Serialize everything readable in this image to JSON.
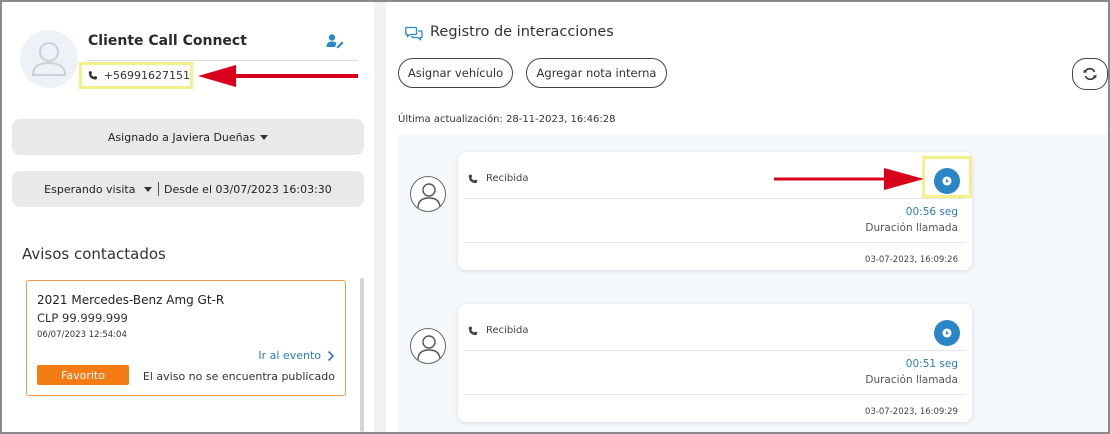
{
  "contact": {
    "name": "Cliente Call Connect",
    "phone": "+56991627151"
  },
  "assignment": {
    "label": "Asignado a Javiera Dueñas"
  },
  "status": {
    "label": "Esperando visita",
    "since": "Desde el 03/07/2023 16:03:30"
  },
  "avisos": {
    "title": "Avisos contactados",
    "items": [
      {
        "title": "2021 Mercedes-Benz Amg Gt-R",
        "price": "CLP 99.999.999",
        "date": "06/07/2023 12:54:04",
        "link": "Ir al evento",
        "favorite": "Favorito",
        "status": "El aviso no se encuentra publicado"
      }
    ]
  },
  "registro": {
    "title": "Registro de interacciones",
    "actions": {
      "assign_vehicle": "Asignar vehículo",
      "add_note": "Agregar nota interna"
    },
    "last_update": "Última actualización: 28-11-2023, 16:46:28",
    "entries": [
      {
        "kind": "Recibida",
        "duration": "00:56 seg",
        "duration_label": "Duración llamada",
        "timestamp": "03-07-2023, 16:09:26"
      },
      {
        "kind": "Recibida",
        "duration": "00:51 seg",
        "duration_label": "Duración llamada",
        "timestamp": "03-07-2023, 16:09:29"
      }
    ]
  },
  "colors": {
    "accent": "#2b86c8",
    "favorite": "#f57b14",
    "highlight": "#f4f08a",
    "annotation_arrow": "#d9001b",
    "card_border": "#f29a4a"
  },
  "icons": [
    "user-avatar-icon",
    "edit-user-icon",
    "phone-icon",
    "chat-icon",
    "refresh-icon",
    "play-icon",
    "chevron-right-icon"
  ]
}
